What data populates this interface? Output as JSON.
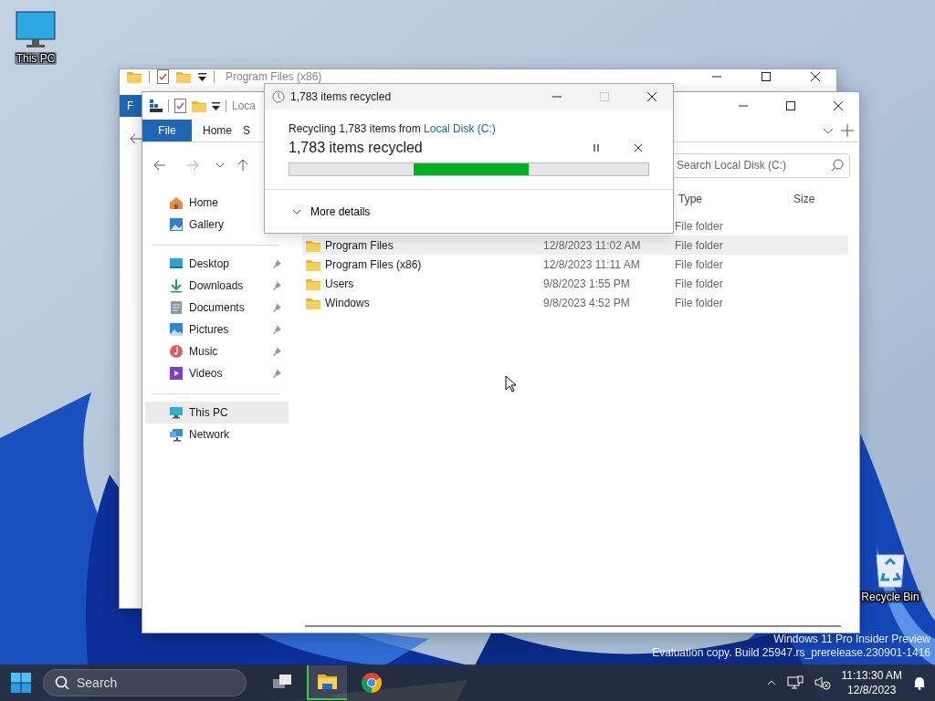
{
  "desktop_icons": [
    {
      "label": "This PC",
      "kind": "pc"
    },
    {
      "label": "Recycle Bin",
      "kind": "bin"
    }
  ],
  "back_window": {
    "title": "Program Files (x86)",
    "ribbon_tab": "F"
  },
  "explorer": {
    "title": "Loca",
    "ribbon_tabs": [
      {
        "label": "File",
        "selected": true
      },
      {
        "label": "Home",
        "selected": false
      },
      {
        "label": "S",
        "selected": false
      }
    ],
    "search": {
      "placeholder": "Search Local Disk (C:)"
    },
    "sidebar": [
      {
        "items": [
          {
            "label": "Home",
            "kind": "home",
            "pinned": false,
            "selected": false
          },
          {
            "label": "Gallery",
            "kind": "gallery",
            "pinned": false,
            "selected": false
          }
        ]
      },
      {
        "items": [
          {
            "label": "Desktop",
            "kind": "desktop",
            "pinned": true,
            "selected": false
          },
          {
            "label": "Downloads",
            "kind": "downloads",
            "pinned": true,
            "selected": false
          },
          {
            "label": "Documents",
            "kind": "documents",
            "pinned": true,
            "selected": false
          },
          {
            "label": "Pictures",
            "kind": "pictures",
            "pinned": true,
            "selected": false
          },
          {
            "label": "Music",
            "kind": "music",
            "pinned": true,
            "selected": false
          },
          {
            "label": "Videos",
            "kind": "videos",
            "pinned": true,
            "selected": false
          }
        ]
      },
      {
        "items": [
          {
            "label": "This PC",
            "kind": "pc",
            "pinned": false,
            "selected": true
          },
          {
            "label": "Network",
            "kind": "network",
            "pinned": false,
            "selected": false
          }
        ]
      }
    ],
    "columns": [
      "Type",
      "Size"
    ],
    "rows": [
      {
        "type": "File folder",
        "hovered": false
      },
      {
        "name": "Program Files",
        "modified": "12/8/2023 11:02 AM",
        "type": "File folder",
        "hovered": true
      },
      {
        "name": "Program Files (x86)",
        "modified": "12/8/2023 11:11 AM",
        "type": "File folder",
        "hovered": false
      },
      {
        "name": "Users",
        "modified": "9/8/2023 1:55 PM",
        "type": "File folder",
        "hovered": false
      },
      {
        "name": "Windows",
        "modified": "9/8/2023 4:52 PM",
        "type": "File folder",
        "hovered": false
      }
    ]
  },
  "dialog": {
    "title": "1,783 items recycled",
    "maximize_disabled": true,
    "message": "Recycling 1,783 items from ",
    "source_link": "Local Disk (C:)",
    "status": "1,783 items recycled",
    "progress": {
      "indeterminate": true
    },
    "details_label": "More details"
  },
  "watermark": {
    "edition": "Windows 11 Pro Insider Preview",
    "build": "Evaluation copy. Build 25947.rs_prerelease.230901-1416"
  },
  "taskbar": {
    "search_placeholder": "Search",
    "apps": [
      {
        "kind": "taskview",
        "active": false
      },
      {
        "kind": "explorer",
        "active": true
      },
      {
        "kind": "chrome",
        "active": false
      }
    ],
    "time": "11:13:30 AM",
    "date": "12/8/2023"
  }
}
